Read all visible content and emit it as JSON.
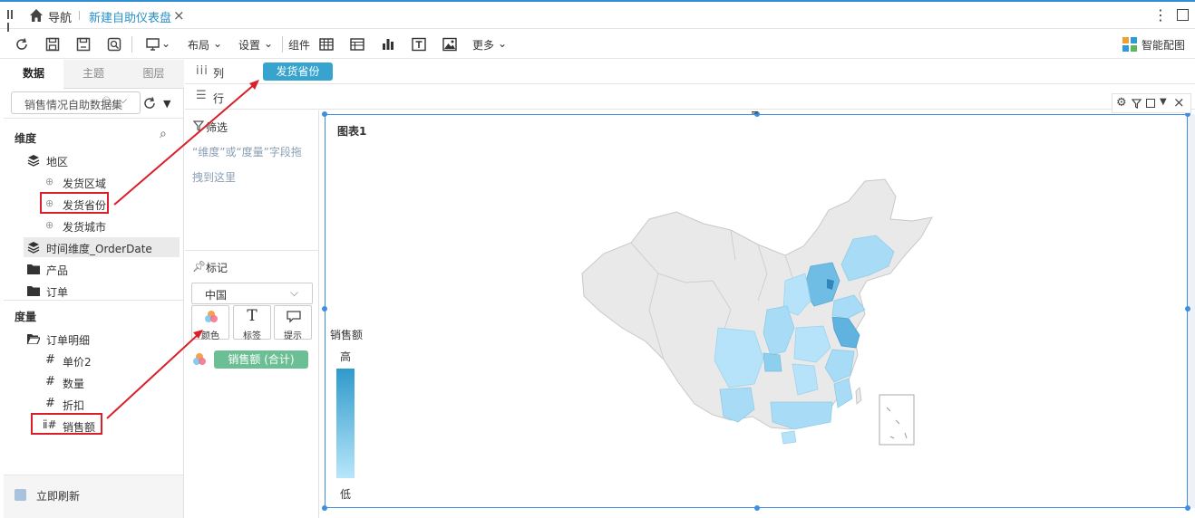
{
  "tabs": {
    "nav_label": "导航",
    "active_tab": "新建自助仪表盘"
  },
  "toolbar": {
    "layout": "布局",
    "settings": "设置",
    "components": "组件",
    "more": "更多",
    "smart": "智能配图"
  },
  "left": {
    "tabs": [
      "数据",
      "主题",
      "图层"
    ],
    "dataset": "销售情况自助数据集",
    "dim_header": "维度",
    "region": "地区",
    "region_children": [
      "发货区域",
      "发货省份",
      "发货城市"
    ],
    "time": "时间维度_OrderDate",
    "product": "产品",
    "order": "订单",
    "measure_header": "度量",
    "order_detail": "订单明细",
    "measures": [
      "单价2",
      "数量",
      "折扣",
      "销售额"
    ],
    "instant_refresh": "立即刷新"
  },
  "shelves": {
    "columns_label": "列",
    "rows_label": "行",
    "column_pill": "发货省份"
  },
  "filter": {
    "title": "筛选",
    "hint": "“维度”或“度量”字段拖拽到这里"
  },
  "marks": {
    "title": "标记",
    "select": "中国",
    "buttons": [
      "颜色",
      "标签",
      "提示"
    ],
    "measure_pill": "销售额 (合计)"
  },
  "chart": {
    "title": "图表1",
    "legend_title": "销售额",
    "legend_high": "高",
    "legend_low": "低",
    "colors": {
      "low": "#b8e6fb",
      "high": "#2f9acb",
      "empty": "#e9e9e9"
    }
  },
  "colors": {
    "accent": "#2f8fd0",
    "pill_blue": "#37a3cf",
    "pill_green": "#6cbf94",
    "annotation": "#d9202a"
  }
}
